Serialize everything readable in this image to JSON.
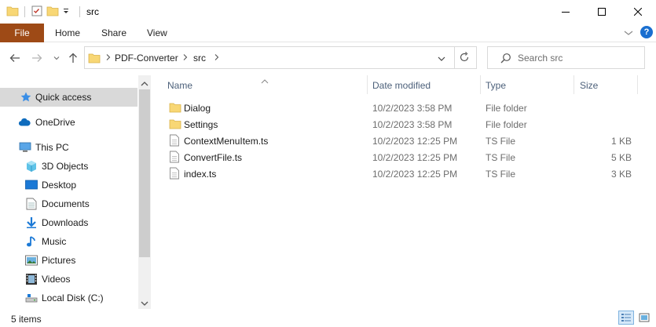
{
  "window": {
    "title": "src",
    "accent": "#9e4a16"
  },
  "ribbon": {
    "tabs": [
      {
        "label": "File"
      },
      {
        "label": "Home"
      },
      {
        "label": "Share"
      },
      {
        "label": "View"
      }
    ],
    "help_label": "?"
  },
  "address": {
    "crumbs": [
      "PDF-Converter",
      "src"
    ]
  },
  "search": {
    "placeholder": "Search src"
  },
  "nav": {
    "items": [
      {
        "label": "Quick access",
        "icon": "star-icon"
      },
      {
        "label": "OneDrive",
        "icon": "cloud-icon"
      },
      {
        "label": "This PC",
        "icon": "computer-icon"
      },
      {
        "label": "3D Objects",
        "icon": "cube-icon"
      },
      {
        "label": "Desktop",
        "icon": "desktop-icon"
      },
      {
        "label": "Documents",
        "icon": "document-icon"
      },
      {
        "label": "Downloads",
        "icon": "download-icon"
      },
      {
        "label": "Music",
        "icon": "music-icon"
      },
      {
        "label": "Pictures",
        "icon": "picture-icon"
      },
      {
        "label": "Videos",
        "icon": "video-icon"
      },
      {
        "label": "Local Disk (C:)",
        "icon": "drive-icon"
      }
    ]
  },
  "columns": {
    "name": "Name",
    "date": "Date modified",
    "type": "Type",
    "size": "Size"
  },
  "files": [
    {
      "name": "Dialog",
      "date": "10/2/2023 3:58 PM",
      "type": "File folder",
      "size": "",
      "icon": "folder-icon"
    },
    {
      "name": "Settings",
      "date": "10/2/2023 3:58 PM",
      "type": "File folder",
      "size": "",
      "icon": "folder-icon"
    },
    {
      "name": "ContextMenuItem.ts",
      "date": "10/2/2023 12:25 PM",
      "type": "TS File",
      "size": "1 KB",
      "icon": "file-icon"
    },
    {
      "name": "ConvertFile.ts",
      "date": "10/2/2023 12:25 PM",
      "type": "TS File",
      "size": "5 KB",
      "icon": "file-icon"
    },
    {
      "name": "index.ts",
      "date": "10/2/2023 12:25 PM",
      "type": "TS File",
      "size": "3 KB",
      "icon": "file-icon"
    }
  ],
  "status": {
    "count": "5 items"
  }
}
